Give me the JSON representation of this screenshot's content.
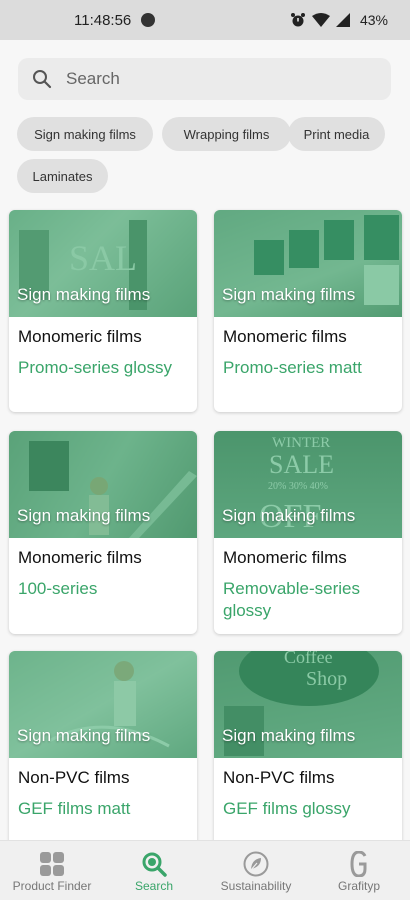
{
  "status_bar": {
    "time": "11:48:56",
    "battery": "43%"
  },
  "search": {
    "placeholder": "Search"
  },
  "filters": [
    "Sign making films",
    "Wrapping films",
    "Print media",
    "Laminates"
  ],
  "cards": [
    {
      "category": "Sign making films",
      "type": "Monomeric films",
      "product": "Promo-series glossy"
    },
    {
      "category": "Sign making films",
      "type": "Monomeric films",
      "product": "Promo-series matt"
    },
    {
      "category": "Sign making films",
      "type": "Monomeric films",
      "product": "100-series"
    },
    {
      "category": "Sign making films",
      "type": "Monomeric films",
      "product": "Removable-series glossy"
    },
    {
      "category": "Sign making films",
      "type": "Non-PVC films",
      "product": "GEF films matt"
    },
    {
      "category": "Sign making films",
      "type": "Non-PVC films",
      "product": "GEF films glossy"
    }
  ],
  "bottom_nav": [
    {
      "label": "Product Finder",
      "icon": "grid-icon"
    },
    {
      "label": "Search",
      "icon": "search-icon",
      "active": true
    },
    {
      "label": "Sustainability",
      "icon": "leaf-icon"
    },
    {
      "label": "Grafityp",
      "icon": "brand-g-icon"
    }
  ],
  "colors": {
    "accent": "#3aa56a",
    "overlay": "#3caa6e"
  }
}
